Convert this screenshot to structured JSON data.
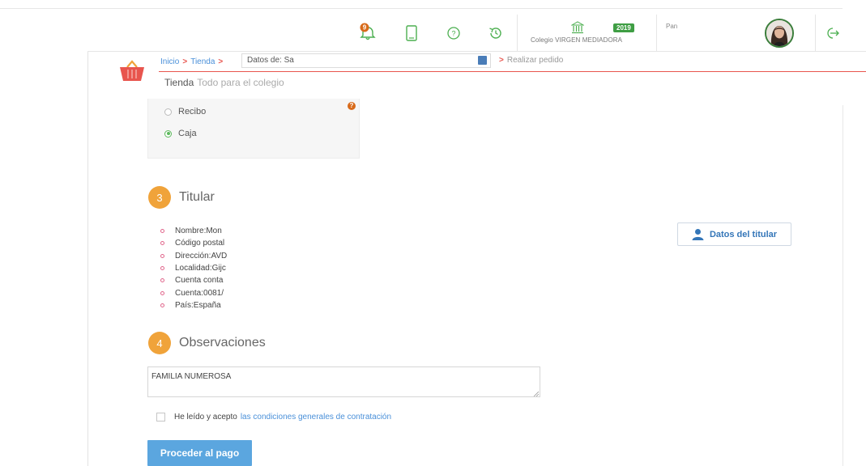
{
  "header": {
    "notification_count": "9",
    "school": {
      "name": "Colegio VIRGEN MEDIADORA",
      "year": "2019"
    },
    "user": {
      "name": "Pan"
    }
  },
  "breadcrumb": {
    "items": [
      "Inicio",
      "Tienda"
    ],
    "datos_label": "Datos de: Sa",
    "next_step": "Realizar pedido"
  },
  "page": {
    "title": "Tienda",
    "subtitle": "Todo para el colegio"
  },
  "payment": {
    "options": [
      {
        "label": "Recibo",
        "selected": false
      },
      {
        "label": "Caja",
        "selected": true
      }
    ]
  },
  "titular": {
    "step_number": "3",
    "title": "Titular",
    "fields": [
      "Nombre:Mon",
      "Código postal",
      "Dirección:AVD",
      "Localidad:Gijc",
      "Cuenta conta",
      "Cuenta:0081/",
      "País:España"
    ],
    "button_label": "Datos del titular"
  },
  "observaciones": {
    "step_number": "4",
    "title": "Observaciones",
    "value": "FAMILIA NUMEROSA"
  },
  "terms": {
    "text": "He leído y acepto",
    "link": "las condiciones generales de contratación"
  },
  "pay_button_label": "Proceder al pago",
  "colors": {
    "accent": "#f0a33a",
    "primary": "#5ba6df",
    "danger": "#e8554e",
    "success": "#3f9e44"
  }
}
